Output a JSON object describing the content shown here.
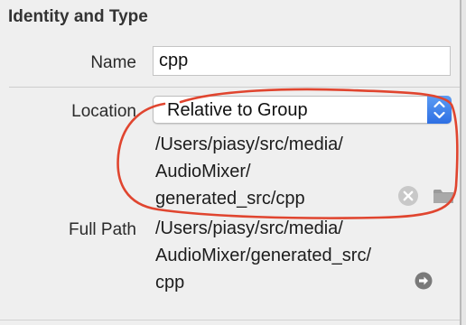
{
  "section": {
    "title": "Identity and Type"
  },
  "name": {
    "label": "Name",
    "value": "cpp"
  },
  "location": {
    "label": "Location",
    "selected": "Relative to Group",
    "path_lines": [
      "/Users/piasy/src/media/",
      "AudioMixer/",
      "generated_src/cpp"
    ]
  },
  "full_path": {
    "label": "Full Path",
    "lines": [
      "/Users/piasy/src/media/",
      "AudioMixer/generated_src/",
      "cpp"
    ]
  },
  "icons": {
    "popup_stepper": "chevron-up-down-icon",
    "clear": "clear-circle-x-icon",
    "folder": "folder-icon",
    "reveal": "arrow-circle-right-icon"
  },
  "colors": {
    "accent": "#3a7ff0",
    "annotation": "#e0452f",
    "icon_gray": "#c8c8c8",
    "reveal_gray": "#7a7a7a"
  }
}
